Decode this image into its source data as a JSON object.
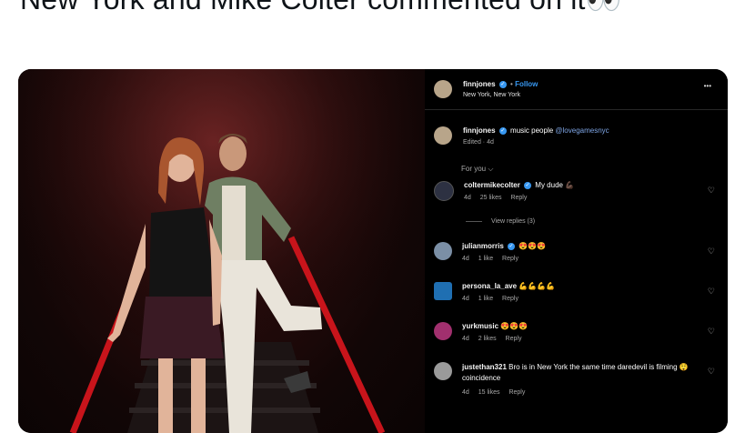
{
  "tweet": {
    "text": "New York and Mike Colter commented on it👀"
  },
  "post": {
    "header": {
      "username": "finnjones",
      "follow": "Follow",
      "location": "New York, New York",
      "more": "•••"
    },
    "caption": {
      "username": "finnjones",
      "text": "music people",
      "mention": "@lovegamesnyc",
      "edited": "Edited · 4d"
    },
    "for_you": "For you ⌵",
    "comments": [
      {
        "username": "coltermikecolter",
        "text": "My dude 💪🏿",
        "time": "4d",
        "likes": "25 likes",
        "reply": "Reply",
        "view_replies": "View replies (3)",
        "avatar_color": "#2d3142",
        "verified": true
      },
      {
        "username": "julianmorris",
        "text": "😍😍😍",
        "time": "4d",
        "likes": "1 like",
        "reply": "Reply",
        "avatar_color": "#7b8fa6",
        "verified": true
      },
      {
        "username": "persona_la_ave",
        "text": "💪💪💪💪",
        "time": "4d",
        "likes": "1 like",
        "reply": "Reply",
        "avatar_color": "#1f6fb2",
        "verified": false
      },
      {
        "username": "yurkmusic",
        "text": "😍😍😍",
        "time": "4d",
        "likes": "2 likes",
        "reply": "Reply",
        "avatar_color": "#a1306e",
        "verified": false
      },
      {
        "username": "justethan321",
        "text": "Bro is in New York the same time daredevil is filming 😲 coincidence",
        "time": "4d",
        "likes": "15 likes",
        "reply": "Reply",
        "avatar_color": "#9a9a9a",
        "verified": false
      }
    ]
  },
  "colors": {
    "verified": "#3797f0",
    "follow": "#3797f0",
    "mention": "#7fa6e6",
    "railing": "#c8141b"
  }
}
